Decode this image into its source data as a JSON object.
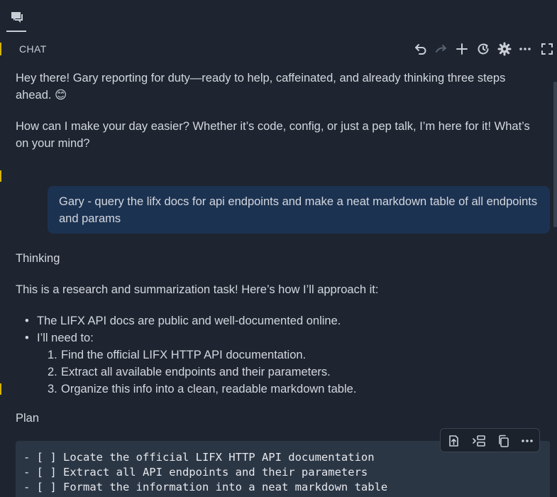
{
  "header": {
    "title": "CHAT",
    "toolbar_icons": [
      "undo-icon",
      "redo-icon",
      "new-chat-icon",
      "history-icon",
      "settings-icon",
      "more-icon",
      "maximize-icon"
    ]
  },
  "messages": {
    "greeting_1": "Hey there! Gary reporting for duty—ready to help, caffeinated, and already thinking three steps ahead. 😊",
    "greeting_2": "How can I make your day easier? Whether it’s code, config, or just a pep talk, I’m here for it! What’s on your mind?",
    "user_prompt": "Gary - query the lifx docs for api endpoints and make a neat markdown table of all endpoints and params",
    "thinking_label": "Thinking",
    "intro": "This is a research and summarization task! Here’s how I’ll approach it:",
    "bullet_1": "The LIFX API docs are public and well-documented online.",
    "bullet_2": "I’ll need to:",
    "steps": [
      {
        "num": "1.",
        "text": "Find the official LIFX HTTP API documentation."
      },
      {
        "num": "2.",
        "text": "Extract all available endpoints and their parameters."
      },
      {
        "num": "3.",
        "text": "Organize this info into a clean, readable markdown table."
      }
    ],
    "plan_label": "Plan"
  },
  "code_block": {
    "lines": [
      "- [ ] Locate the official LIFX HTTP API documentation",
      "- [ ] Extract all API endpoints and their parameters",
      "- [ ] Format the information into a neat markdown table"
    ],
    "toolbar_icons": [
      "apply-in-editor-icon",
      "insert-at-cursor-icon",
      "copy-icon",
      "more-icon"
    ]
  },
  "colors": {
    "background": "#1e2530",
    "user_bubble": "#1c3251",
    "code_background": "#2b3645",
    "text": "#d3d7de"
  }
}
